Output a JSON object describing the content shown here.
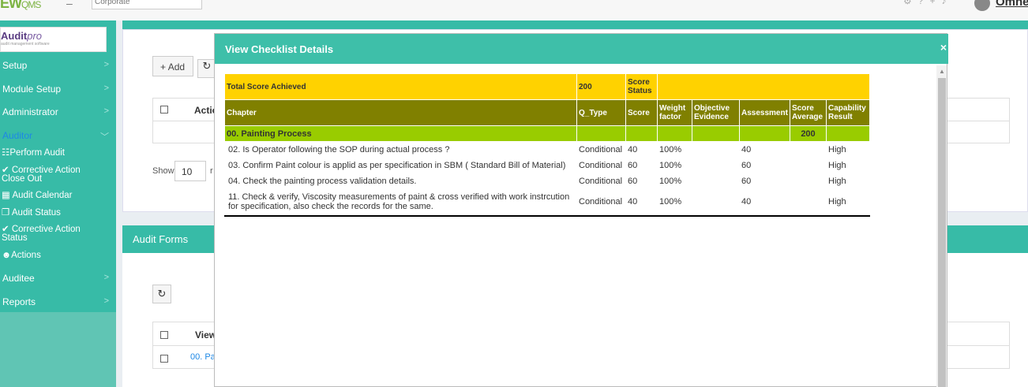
{
  "topbar": {
    "logo": "EW",
    "logo_suffix": "QMS",
    "plant_select": "Corporate",
    "brand": "Omne"
  },
  "sidebar": {
    "app_title": "Audit",
    "app_title_suffix": "pro",
    "app_tagline": "audit management software",
    "items": [
      {
        "label": "Setup"
      },
      {
        "label": "Module Setup"
      },
      {
        "label": "Administrator"
      },
      {
        "label": "Auditor"
      },
      {
        "label": "Auditee"
      },
      {
        "label": "Reports"
      }
    ],
    "auditor_sub": [
      {
        "label": "Perform Audit"
      },
      {
        "label": "Corrective Action"
      },
      {
        "label": "Close Out"
      },
      {
        "label": "Audit Calendar"
      },
      {
        "label": "Audit Status"
      },
      {
        "label": "Corrective Action"
      },
      {
        "label": "Status"
      },
      {
        "label": "Actions"
      }
    ]
  },
  "background": {
    "add_label": "Add",
    "col_action": "Actio",
    "show_label": "Show",
    "show_value": "10",
    "show_trail": "r",
    "panel2_title": "Audit Forms",
    "col_view": "View",
    "row_link": "00. Pa"
  },
  "modal": {
    "title": "View Checklist Details",
    "close": "×",
    "total_label": "Total Score Achieved",
    "total_value": "200",
    "score_status_label": "Score Status",
    "headers": {
      "chapter": "Chapter",
      "q_type": "Q_Type",
      "score": "Score",
      "weight": "Weight factor",
      "evidence": "Objective Evidence",
      "assessment": "Assessment",
      "score_avg": "Score Average",
      "capability": "Capability Result"
    },
    "chapter_row": {
      "name": "00. Painting Process",
      "score_average": "200"
    },
    "rows": [
      {
        "question": "02. Is Operator following the SOP during actual process ?",
        "q_type": "Conditional",
        "score": "40",
        "weight": "100%",
        "evidence": "",
        "assessment": "40",
        "score_avg": "",
        "capability": "High"
      },
      {
        "question": "03. Confirm Paint colour is applid as per specification in SBM ( Standard Bill of Material)",
        "q_type": "Conditional",
        "score": "60",
        "weight": "100%",
        "evidence": "",
        "assessment": "60",
        "score_avg": "",
        "capability": "High"
      },
      {
        "question": "04. Check the painting process validation details.",
        "q_type": "Conditional",
        "score": "60",
        "weight": "100%",
        "evidence": "",
        "assessment": "60",
        "score_avg": "",
        "capability": "High"
      },
      {
        "question": "11. Check & verify, Viscosity measurements of paint & cross verified with work instrcution for specification, also check the records for the same.",
        "q_type": "Conditional",
        "score": "40",
        "weight": "100%",
        "evidence": "",
        "assessment": "40",
        "score_avg": "",
        "capability": "High"
      }
    ]
  }
}
